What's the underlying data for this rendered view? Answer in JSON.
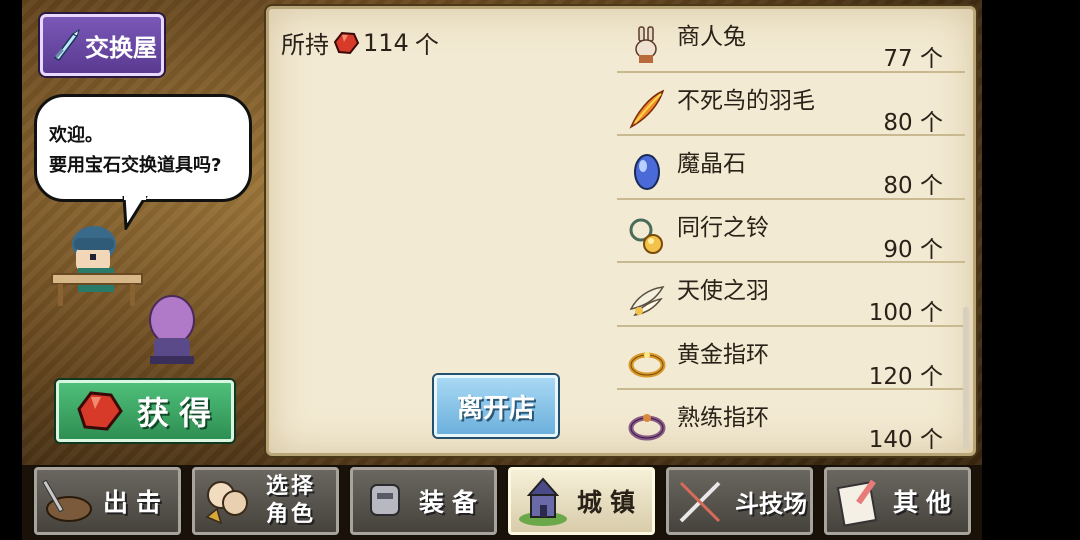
{
  "shop": {
    "title": "交换屋",
    "icon": "crystal-sword-icon"
  },
  "dialog": {
    "line1": "欢迎。",
    "line2": "要用宝石交换道具吗?"
  },
  "owned": {
    "label": "所持",
    "count": "114",
    "unit": "个",
    "icon": "red-gem-icon"
  },
  "obtain_button": {
    "label": "获得",
    "icon": "red-gem-icon"
  },
  "leave_button": {
    "label": "离开店"
  },
  "items": [
    {
      "name": "商人兔",
      "price": "77 个",
      "icon": "merchant-rabbit-icon"
    },
    {
      "name": "不死鸟的羽毛",
      "price": "80 个",
      "icon": "phoenix-feather-icon"
    },
    {
      "name": "魔晶石",
      "price": "80 个",
      "icon": "magic-crystal-icon"
    },
    {
      "name": "同行之铃",
      "price": "90 个",
      "icon": "companion-bell-icon"
    },
    {
      "name": "天使之羽",
      "price": "100 个",
      "icon": "angel-wing-icon"
    },
    {
      "name": "黄金指环",
      "price": "120 个",
      "icon": "gold-ring-icon"
    },
    {
      "name": "熟练指环",
      "price": "140 个",
      "icon": "skill-ring-icon"
    }
  ],
  "nav": [
    {
      "label": "出击",
      "icon": "sortie-icon"
    },
    {
      "label": "选择角色",
      "line1": "选择",
      "line2": "角色",
      "icon": "character-select-icon"
    },
    {
      "label": "装备",
      "icon": "equipment-icon"
    },
    {
      "label": "城镇",
      "icon": "town-icon",
      "active": true
    },
    {
      "label": "斗技场",
      "icon": "arena-icon"
    },
    {
      "label": "其他",
      "icon": "other-icon"
    }
  ],
  "colors": {
    "parchment": "#f3ead3",
    "obtain_green": "#3aa862",
    "leave_blue": "#86c4e8",
    "shop_purple": "#6a48a8"
  }
}
